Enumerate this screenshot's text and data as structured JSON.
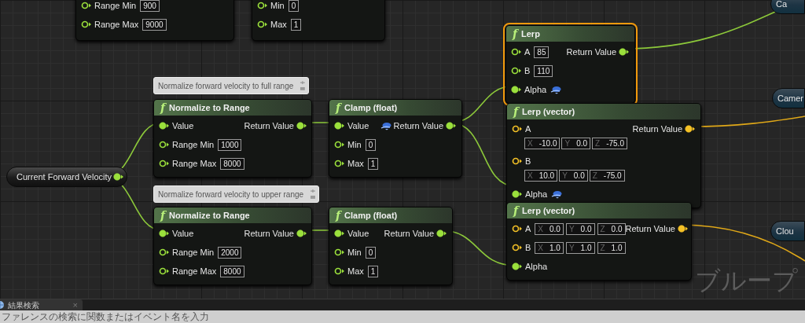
{
  "nodes": [
    {
      "selected": false,
      "inputs": [
        {
          "label": "Range Min",
          "kind": "float",
          "connected": false,
          "value": "900"
        },
        {
          "label": "Range Max",
          "kind": "float",
          "connected": false,
          "value": "9000"
        }
      ]
    },
    {
      "selected": false,
      "inputs": [
        {
          "label": "Min",
          "kind": "float",
          "connected": false,
          "value": "0"
        },
        {
          "label": "Max",
          "kind": "float",
          "connected": false,
          "value": "1"
        }
      ]
    },
    {
      "glyph": "f",
      "title": "Normalize to Range",
      "selected": false,
      "inputs": [
        {
          "label": "Value",
          "kind": "float",
          "connected": true
        },
        {
          "label": "Range Min",
          "kind": "float",
          "connected": false,
          "value": "1000"
        },
        {
          "label": "Range Max",
          "kind": "float",
          "connected": false,
          "value": "8000"
        }
      ],
      "outputs": [
        {
          "label": "Return Value",
          "kind": "float",
          "connected": true
        }
      ]
    },
    {
      "glyph": "f",
      "title": "Clamp (float)",
      "selected": false,
      "inputs": [
        {
          "label": "Value",
          "kind": "float",
          "connected": true
        },
        {
          "label": "Min",
          "kind": "float",
          "connected": false,
          "value": "0"
        },
        {
          "label": "Max",
          "kind": "float",
          "connected": false,
          "value": "1"
        }
      ],
      "outputs": [
        {
          "label": "Return Value",
          "kind": "float",
          "connected": true,
          "icon": true
        }
      ]
    },
    {
      "glyph": "f",
      "title": "Lerp",
      "selected": true,
      "inputs": [
        {
          "label": "A",
          "kind": "float",
          "connected": false,
          "value": "85"
        },
        {
          "label": "B",
          "kind": "float",
          "connected": false,
          "value": "110"
        },
        {
          "label": "Alpha",
          "kind": "float",
          "connected": true,
          "icon": true
        }
      ],
      "outputs": [
        {
          "label": "Return Value",
          "kind": "float",
          "connected": true
        }
      ]
    },
    {
      "glyph": "f",
      "title": "Lerp (vector)",
      "selected": false,
      "inputs": [
        {
          "label": "A",
          "kind": "vector",
          "connected": false,
          "vector": [
            {
              "axis": "X",
              "value": "-10.0"
            },
            {
              "axis": "Y",
              "value": "0.0"
            },
            {
              "axis": "Z",
              "value": "-75.0"
            }
          ]
        },
        {
          "label": "B",
          "kind": "vector",
          "connected": false,
          "vector": [
            {
              "axis": "X",
              "value": "10.0"
            },
            {
              "axis": "Y",
              "value": "0.0"
            },
            {
              "axis": "Z",
              "value": "-75.0"
            }
          ]
        },
        {
          "label": "Alpha",
          "kind": "float",
          "connected": true,
          "icon": true
        }
      ],
      "outputs": [
        {
          "label": "Return Value",
          "kind": "vector",
          "connected": true
        }
      ]
    },
    {
      "glyph": "f",
      "title": "Normalize to Range",
      "selected": false,
      "inputs": [
        {
          "label": "Value",
          "kind": "float",
          "connected": true
        },
        {
          "label": "Range Min",
          "kind": "float",
          "connected": false,
          "value": "2000"
        },
        {
          "label": "Range Max",
          "kind": "float",
          "connected": false,
          "value": "8000"
        }
      ],
      "outputs": [
        {
          "label": "Return Value",
          "kind": "float",
          "connected": true
        }
      ]
    },
    {
      "glyph": "f",
      "title": "Clamp (float)",
      "selected": false,
      "inputs": [
        {
          "label": "Value",
          "kind": "float",
          "connected": true
        },
        {
          "label": "Min",
          "kind": "float",
          "connected": false,
          "value": "0"
        },
        {
          "label": "Max",
          "kind": "float",
          "connected": false,
          "value": "1"
        }
      ],
      "outputs": [
        {
          "label": "Return Value",
          "kind": "float",
          "connected": true
        }
      ]
    },
    {
      "glyph": "f",
      "title": "Lerp (vector)",
      "selected": false,
      "inputs": [
        {
          "label": "A",
          "kind": "vector",
          "connected": false,
          "vector": [
            {
              "axis": "X",
              "value": "0.0"
            },
            {
              "axis": "Y",
              "value": "0.0"
            },
            {
              "axis": "Z",
              "value": "0.0"
            }
          ]
        },
        {
          "label": "B",
          "kind": "vector",
          "connected": false,
          "vector": [
            {
              "axis": "X",
              "value": "1.0"
            },
            {
              "axis": "Y",
              "value": "1.0"
            },
            {
              "axis": "Z",
              "value": "1.0"
            }
          ]
        },
        {
          "label": "Alpha",
          "kind": "float",
          "connected": true
        }
      ],
      "outputs": [
        {
          "label": "Return Value",
          "kind": "vector",
          "connected": true
        }
      ]
    }
  ],
  "variables": [
    {
      "label": "Current Forward Velocity",
      "kind": "float",
      "output_pin": {
        "kind": "float",
        "connected": true
      }
    },
    {
      "label": "Ca",
      "kind": "object"
    },
    {
      "label": "Camer",
      "kind": "object"
    },
    {
      "label": "Clou",
      "kind": "object"
    }
  ],
  "comments": [
    {
      "text": "Normalize forward velocity to full range"
    },
    {
      "text": "Normalize forward velocity to upper range"
    }
  ],
  "graph_label": "ブループ",
  "bottom_panel": {
    "tab": {
      "label": "結果検索",
      "close": "×",
      "selected": true
    },
    "search": {
      "placeholder": "ファレンスの検索に関数またはイベント名を入力"
    }
  }
}
